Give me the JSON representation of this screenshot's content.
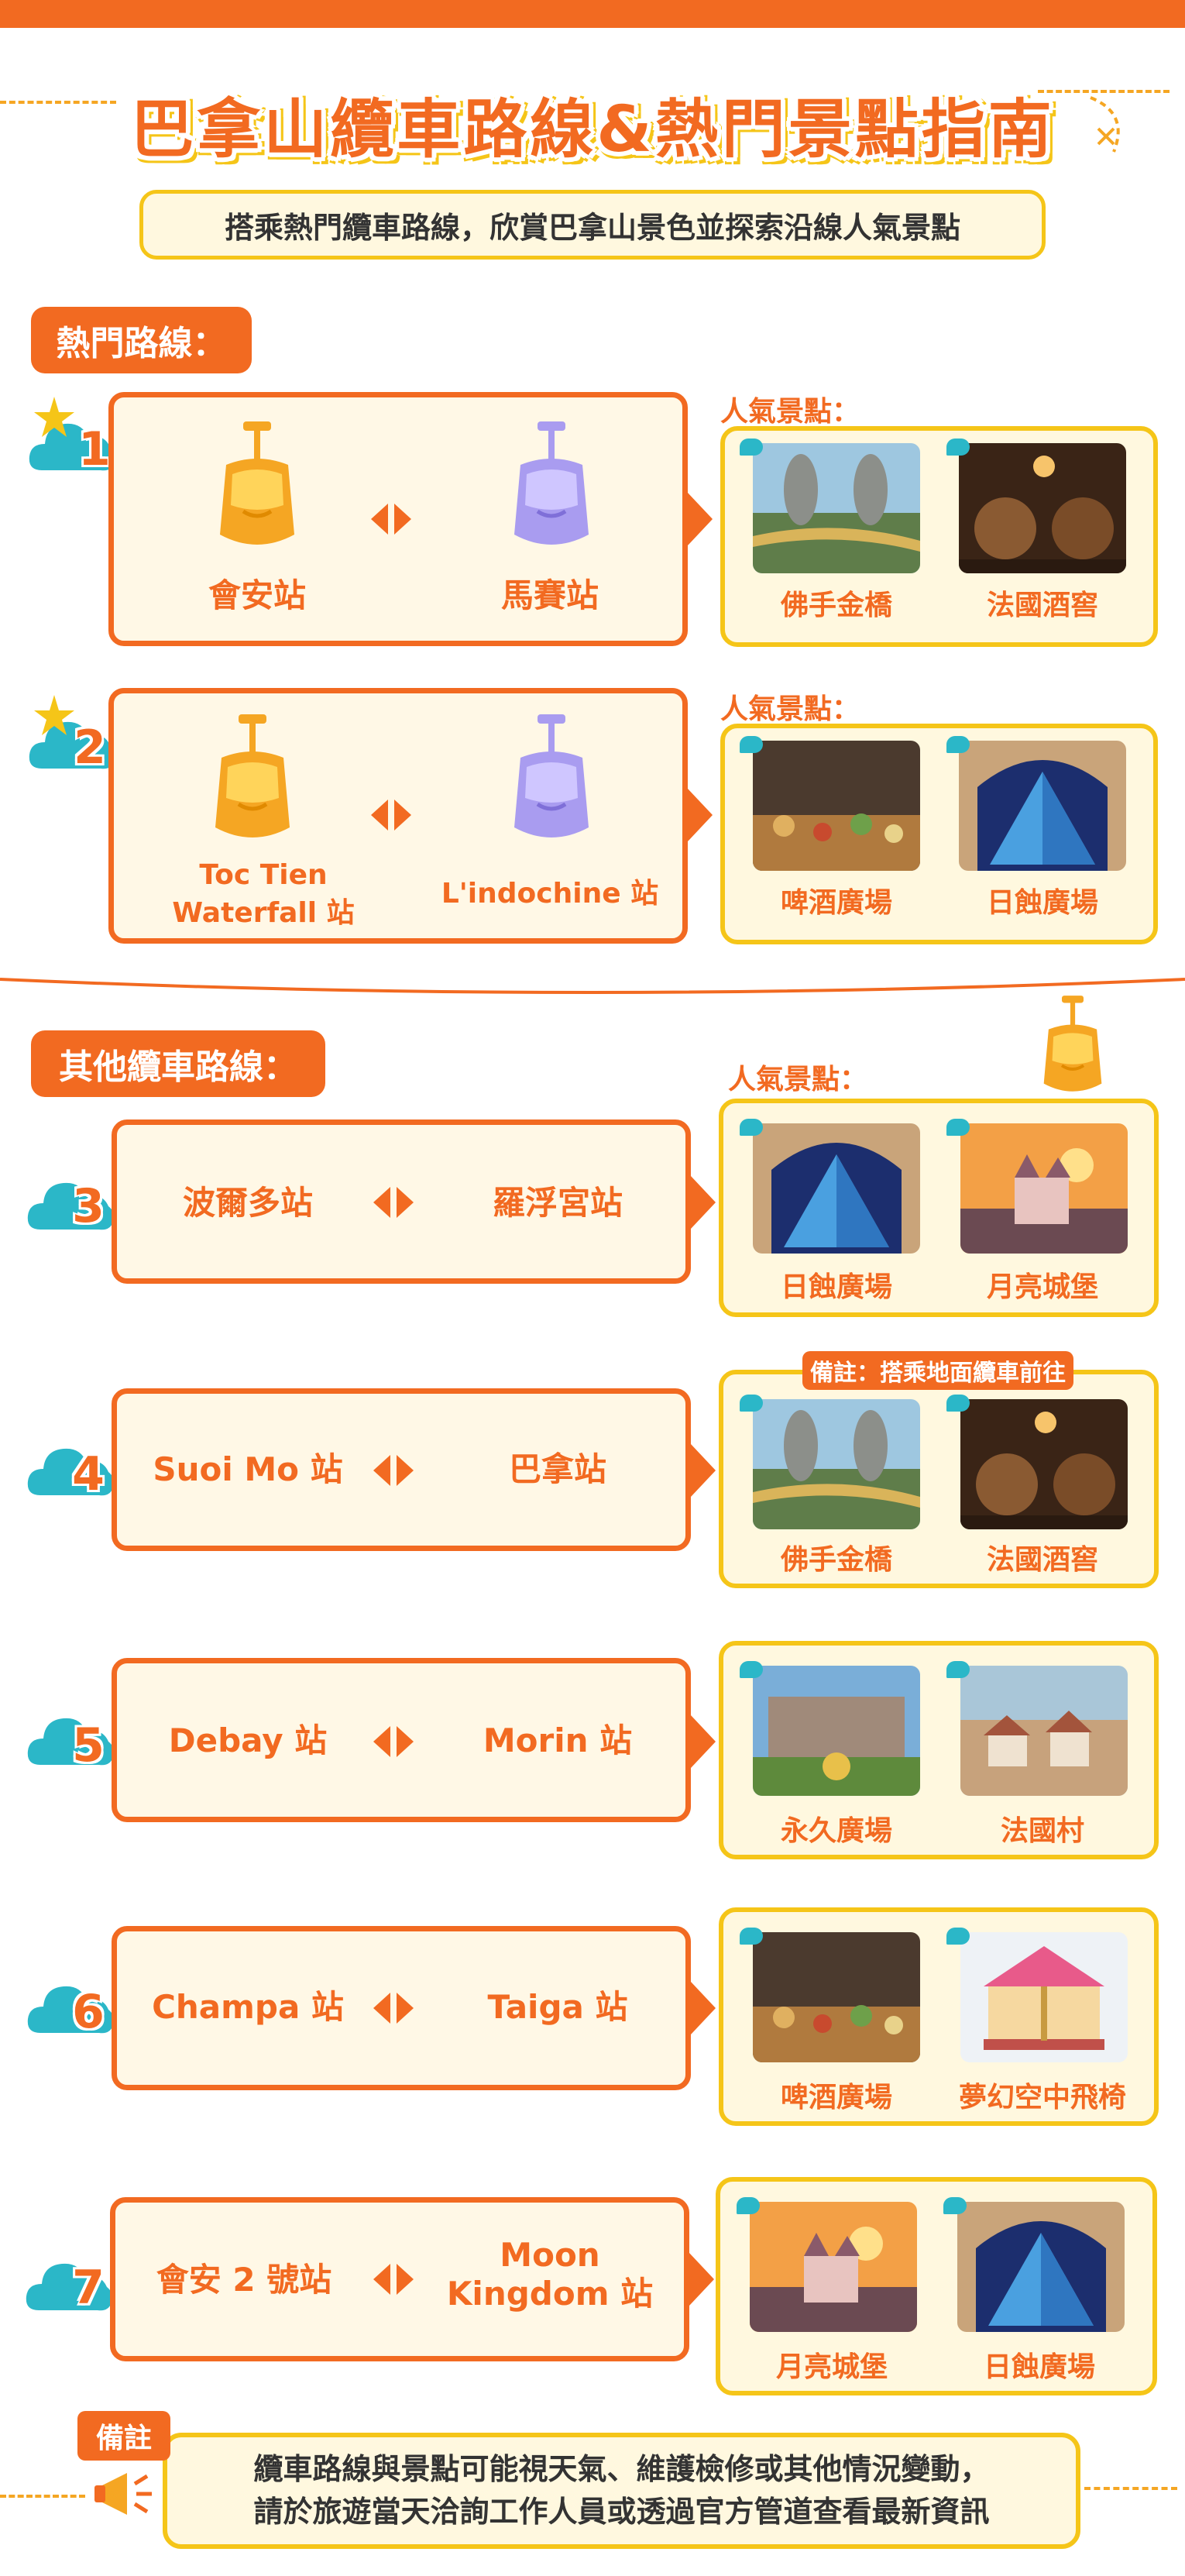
{
  "header": {
    "title": "巴拿山纜車路線&熱門景點指南",
    "subtitle": "搭乘熱門纜車路線，欣賞巴拿山景色並探索沿線人氣景點"
  },
  "popular_section": {
    "label": "熱門路線："
  },
  "other_section": {
    "label": "其他纜車路線："
  },
  "spots_title": "人氣景點：",
  "routes": [
    {
      "number": "1",
      "from": "會安站",
      "to": "馬賽站",
      "spots": [
        "佛手金橋",
        "法國酒窖"
      ]
    },
    {
      "number": "2",
      "from_line1": "Toc Tien",
      "from_line2": "Waterfall 站",
      "to": "L'indochine 站",
      "spots": [
        "啤酒廣場",
        "日蝕廣場"
      ]
    },
    {
      "number": "3",
      "from": "波爾多站",
      "to": "羅浮宮站",
      "spots": [
        "日蝕廣場",
        "月亮城堡"
      ]
    },
    {
      "number": "4",
      "from": "Suoi Mo 站",
      "to": "巴拿站",
      "spots": [
        "佛手金橋",
        "法國酒窖"
      ],
      "note": "備註：搭乘地面纜車前往"
    },
    {
      "number": "5",
      "from": "Debay 站",
      "to": "Morin 站",
      "spots": [
        "永久廣場",
        "法國村"
      ]
    },
    {
      "number": "6",
      "from": "Champa 站",
      "to": "Taiga 站",
      "spots": [
        "啤酒廣場",
        "夢幻空中飛椅"
      ]
    },
    {
      "number": "7",
      "from": "會安 2 號站",
      "to_line1": "Moon",
      "to_line2": "Kingdom 站",
      "spots": [
        "月亮城堡",
        "日蝕廣場"
      ]
    }
  ],
  "footer": {
    "tag": "備註",
    "line1": "纜車路線與景點可能視天氣、維護檢修或其他情況變動，",
    "line2": "請於旅遊當天洽詢工作人員或透過官方管道查看最新資訊"
  },
  "colors": {
    "accent_orange": "#f26a21",
    "accent_yellow": "#f5c518",
    "cloud_teal": "#2bb7c8",
    "panel_cream": "#fff8e6"
  }
}
